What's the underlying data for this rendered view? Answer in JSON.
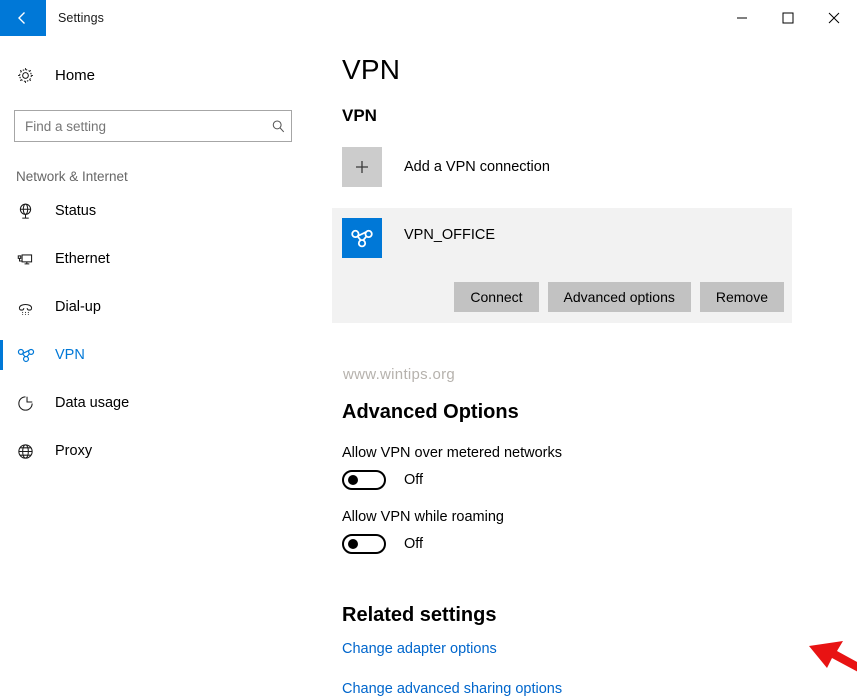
{
  "window": {
    "title": "Settings",
    "back_icon": "back-arrow-icon",
    "minimize_label": "Minimize",
    "maximize_label": "Maximize",
    "close_label": "Close",
    "accent_color": "#0078d7"
  },
  "sidebar": {
    "home_label": "Home",
    "home_icon": "gear-icon",
    "search": {
      "placeholder": "Find a setting",
      "value": "",
      "icon": "search-icon"
    },
    "category_label": "Network & Internet",
    "items": [
      {
        "label": "Status",
        "icon": "globe-stand-icon",
        "selected": false
      },
      {
        "label": "Ethernet",
        "icon": "ethernet-icon",
        "selected": false
      },
      {
        "label": "Dial-up",
        "icon": "dialup-phone-icon",
        "selected": false
      },
      {
        "label": "VPN",
        "icon": "vpn-knot-icon",
        "selected": true
      },
      {
        "label": "Data usage",
        "icon": "pie-chart-icon",
        "selected": false
      },
      {
        "label": "Proxy",
        "icon": "globe-icon",
        "selected": false
      }
    ]
  },
  "main": {
    "page_title": "VPN",
    "vpn_group_title": "VPN",
    "add_connection": {
      "label": "Add a VPN connection",
      "icon": "plus-icon"
    },
    "connection": {
      "name": "VPN_OFFICE",
      "icon": "vpn-knot-icon",
      "buttons": [
        {
          "label": "Connect"
        },
        {
          "label": "Advanced options"
        },
        {
          "label": "Remove"
        }
      ]
    },
    "watermark": "www.wintips.org",
    "advanced": {
      "title": "Advanced Options",
      "toggles": [
        {
          "label": "Allow VPN over metered networks",
          "state": "Off"
        },
        {
          "label": "Allow VPN while roaming",
          "state": "Off"
        }
      ]
    },
    "related": {
      "title": "Related settings",
      "links": [
        {
          "label": "Change adapter options"
        },
        {
          "label": "Change advanced sharing options"
        }
      ]
    },
    "annotation": {
      "name": "red-arrow-pointer",
      "color": "#e81313"
    }
  }
}
